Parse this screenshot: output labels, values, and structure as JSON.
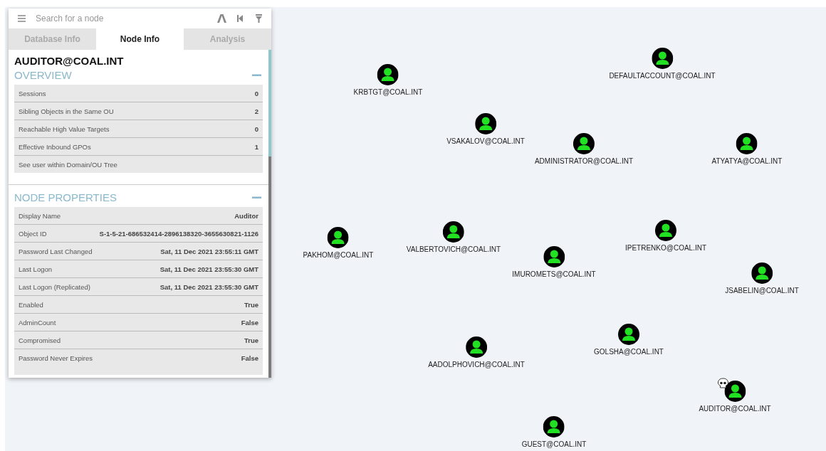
{
  "search": {
    "placeholder": "Search for a node"
  },
  "tabs": [
    {
      "label": "Database Info",
      "selected": false
    },
    {
      "label": "Node Info",
      "selected": true
    },
    {
      "label": "Analysis",
      "selected": false
    }
  ],
  "node_title": "AUDITOR@COAL.INT",
  "sections": [
    {
      "title": "OVERVIEW",
      "expanded": true,
      "rows": [
        {
          "label": "Sessions",
          "value": "0"
        },
        {
          "label": "Sibling Objects in the Same OU",
          "value": "2"
        },
        {
          "label": "Reachable High Value Targets",
          "value": "0"
        },
        {
          "label": "Effective Inbound GPOs",
          "value": "1"
        },
        {
          "label": "See user within Domain/OU Tree"
        }
      ]
    },
    {
      "title": "NODE PROPERTIES",
      "expanded": true,
      "rows": [
        {
          "label": "Display Name",
          "value": "Auditor"
        },
        {
          "label": "Object ID",
          "value": "S-1-5-21-686532414-2896138320-3655630821-1126"
        },
        {
          "label": "Password Last Changed",
          "value": "Sat, 11 Dec 2021 23:55:11 GMT"
        },
        {
          "label": "Last Logon",
          "value": "Sat, 11 Dec 2021 23:55:30 GMT"
        },
        {
          "label": "Last Logon (Replicated)",
          "value": "Sat, 11 Dec 2021 23:55:30 GMT"
        },
        {
          "label": "Enabled",
          "value": "True"
        },
        {
          "label": "AdminCount",
          "value": "False"
        },
        {
          "label": "Compromised",
          "value": "True"
        },
        {
          "label": "Password Never Expires",
          "value": "False"
        }
      ]
    }
  ],
  "graph": {
    "nodes": [
      {
        "label": "KRBTGT@COAL.INT",
        "owned": false
      },
      {
        "label": "DEFAULTACCOUNT@COAL.INT",
        "owned": false
      },
      {
        "label": "VSAKALOV@COAL.INT",
        "owned": false
      },
      {
        "label": "ADMINISTRATOR@COAL.INT",
        "owned": false
      },
      {
        "label": "ATYATYA@COAL.INT",
        "owned": false
      },
      {
        "label": "PAKHOM@COAL.INT",
        "owned": false
      },
      {
        "label": "VALBERTOVICH@COAL.INT",
        "owned": false
      },
      {
        "label": "IPETRENKO@COAL.INT",
        "owned": false
      },
      {
        "label": "IMUROMETS@COAL.INT",
        "owned": false
      },
      {
        "label": "JSABELIN@COAL.INT",
        "owned": false
      },
      {
        "label": "AADOLPHOVICH@COAL.INT",
        "owned": false
      },
      {
        "label": "GOLSHA@COAL.INT",
        "owned": false
      },
      {
        "label": "AUDITOR@COAL.INT",
        "owned": true
      },
      {
        "label": "GUEST@COAL.INT",
        "owned": false
      }
    ]
  }
}
